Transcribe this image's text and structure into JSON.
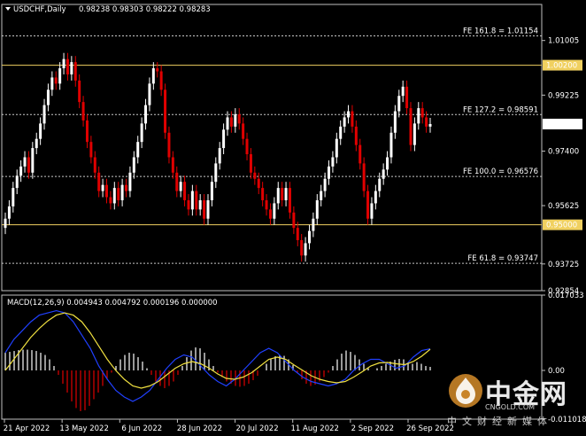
{
  "chart_data": {
    "type": "candlestick",
    "symbol_header": "USDCHF,Daily",
    "ohlc": "0.98238 0.98303 0.98222 0.98283",
    "price_axis": {
      "ylim": [
        0.92854,
        1.0218
      ],
      "ticks": [
        "1.01005",
        "0.99225",
        "0.97400",
        "0.95625",
        "0.93725",
        "0.92854"
      ]
    },
    "date_labels": [
      "21 Apr 2022",
      "13 May 2022",
      "6 Jun 2022",
      "28 Jun 2022",
      "20 Jul 2022",
      "11 Aug 2022",
      "2 Sep 2022",
      "26 Sep 2022"
    ],
    "hlines": [
      {
        "label": "FE 161.8 = 1.01154",
        "value": 1.01154,
        "style": "dotted",
        "color": "#c8c8c8"
      },
      {
        "label": "FE 127.2 = 0.98591",
        "value": 0.98591,
        "style": "dotted",
        "color": "#c8c8c8"
      },
      {
        "label": "FE 100.0 = 0.96576",
        "value": 0.96576,
        "style": "dotted",
        "color": "#c8c8c8"
      },
      {
        "label": "FE 61.8 = 0.93747",
        "value": 0.93747,
        "style": "dotted",
        "color": "#c8c8c8"
      },
      {
        "label": "1.00200",
        "value": 1.002,
        "style": "solid",
        "color": "#f0d060"
      },
      {
        "label": "0.95000",
        "value": 0.95,
        "style": "solid",
        "color": "#f0d060"
      }
    ],
    "current_price_label": "0.98283",
    "closes": [
      0.952,
      0.956,
      0.962,
      0.966,
      0.969,
      0.972,
      0.967,
      0.975,
      0.978,
      0.983,
      0.989,
      0.994,
      0.998,
      0.996,
      1.001,
      1.004,
      0.999,
      1.003,
      0.997,
      0.99,
      0.984,
      0.977,
      0.972,
      0.967,
      0.961,
      0.963,
      0.959,
      0.957,
      0.962,
      0.958,
      0.963,
      0.961,
      0.967,
      0.972,
      0.977,
      0.983,
      0.989,
      0.996,
      1.001,
      1.0,
      0.994,
      0.98,
      0.972,
      0.967,
      0.961,
      0.964,
      0.958,
      0.955,
      0.961,
      0.955,
      0.958,
      0.952,
      0.958,
      0.964,
      0.97,
      0.975,
      0.981,
      0.985,
      0.982,
      0.986,
      0.983,
      0.978,
      0.973,
      0.967,
      0.965,
      0.962,
      0.958,
      0.955,
      0.952,
      0.957,
      0.962,
      0.958,
      0.962,
      0.954,
      0.949,
      0.945,
      0.94,
      0.944,
      0.948,
      0.952,
      0.958,
      0.961,
      0.965,
      0.969,
      0.972,
      0.978,
      0.982,
      0.985,
      0.987,
      0.982,
      0.976,
      0.97,
      0.961,
      0.952,
      0.957,
      0.961,
      0.965,
      0.968,
      0.972,
      0.98,
      0.987,
      0.992,
      0.995,
      0.988,
      0.976,
      0.983,
      0.988,
      0.985,
      0.982,
      0.98283
    ],
    "macd": {
      "label": "MACD(12,26,9) 0.004943 0.004792 0.000196 0.000000",
      "ylim": [
        -0.011018,
        0.017033
      ],
      "ticks": [
        "0.017033",
        "0.00",
        "-0.011018"
      ],
      "histogram": [
        0.004,
        0.0042,
        0.0044,
        0.0046,
        0.0047,
        0.0047,
        0.0046,
        0.0044,
        0.004,
        0.0035,
        0.0025,
        0.001,
        -0.001,
        -0.003,
        -0.005,
        -0.007,
        -0.0085,
        -0.0092,
        -0.009,
        -0.008,
        -0.0065,
        -0.005,
        -0.0035,
        -0.002,
        -0.0005,
        0.001,
        0.0025,
        0.0035,
        0.004,
        0.0038,
        0.003,
        0.002,
        0.0005,
        -0.001,
        -0.0025,
        -0.0035,
        -0.004,
        -0.0035,
        -0.0025,
        -0.001,
        0.001,
        0.003,
        0.0045,
        0.0052,
        0.005,
        0.004,
        0.0025,
        0.001,
        -0.0005,
        -0.0015,
        -0.0025,
        -0.003,
        -0.0035,
        -0.0037,
        -0.0035,
        -0.003,
        -0.0022,
        -0.0012,
        0.0,
        0.0015,
        0.0025,
        0.0032,
        0.0035,
        0.0033,
        0.0025,
        0.0012,
        -0.0005,
        -0.002,
        -0.003,
        -0.0035,
        -0.0032,
        -0.0025,
        -0.0015,
        -0.0005,
        0.001,
        0.0025,
        0.0038,
        0.0045,
        0.0042,
        0.0035,
        0.0025,
        0.0015,
        0.0005,
        0.0,
        0.0005,
        0.001,
        0.0015,
        0.002,
        0.0024,
        0.0026,
        0.0025,
        0.0018,
        0.0015,
        0.0019,
        0.0015,
        0.001,
        0.0008
      ],
      "macd_line": [
        0.004,
        0.007,
        0.009,
        0.011,
        0.0125,
        0.013,
        0.0135,
        0.013,
        0.011,
        0.008,
        0.005,
        0.001,
        -0.002,
        -0.0045,
        -0.006,
        -0.007,
        -0.006,
        -0.0045,
        -0.002,
        0.0005,
        0.0025,
        0.0035,
        0.003,
        0.001,
        -0.001,
        -0.0025,
        -0.0035,
        -0.002,
        0.0,
        0.002,
        0.004,
        0.005,
        0.004,
        0.002,
        0.0,
        -0.0015,
        -0.0025,
        -0.003,
        -0.0035,
        -0.003,
        -0.002,
        0.0,
        0.0015,
        0.0025,
        0.0025,
        0.0015,
        0.0005,
        0.001,
        0.003,
        0.0045,
        0.0049
      ],
      "signal_line": [
        0.0,
        0.0025,
        0.005,
        0.0075,
        0.0095,
        0.0112,
        0.0125,
        0.013,
        0.0125,
        0.011,
        0.0085,
        0.0055,
        0.0025,
        0.0,
        -0.002,
        -0.0035,
        -0.004,
        -0.0035,
        -0.0025,
        -0.001,
        0.0005,
        0.0015,
        0.002,
        0.0015,
        0.0005,
        -0.0008,
        -0.0018,
        -0.002,
        -0.0015,
        -0.0005,
        0.001,
        0.0025,
        0.003,
        0.0025,
        0.0012,
        0.0,
        -0.0012,
        -0.002,
        -0.0025,
        -0.0028,
        -0.0025,
        -0.0015,
        -0.0003,
        0.001,
        0.0017,
        0.0018,
        0.0015,
        0.0013,
        0.002,
        0.0032,
        0.0048
      ]
    }
  },
  "watermark": {
    "brand_cn": "中金网",
    "site": "CNGOLD.COM",
    "slogan_cn": "中文财经新媒体"
  }
}
